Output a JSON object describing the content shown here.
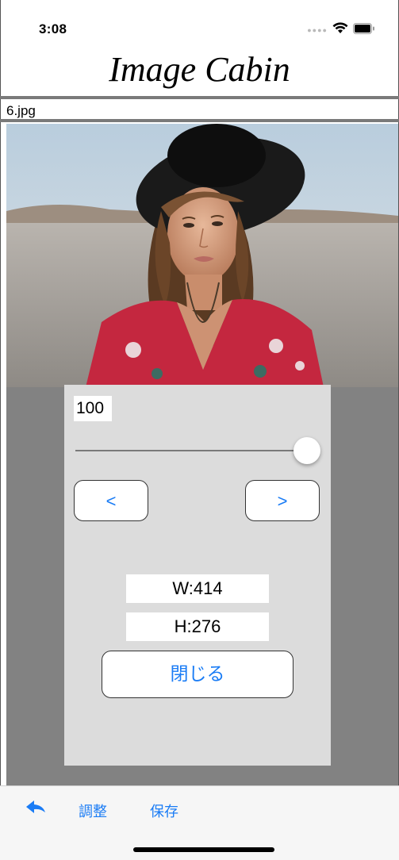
{
  "status_bar": {
    "time": "3:08",
    "icons": [
      "signal-icon",
      "wifi-icon",
      "battery-icon"
    ]
  },
  "header": {
    "title": "Image Cabin"
  },
  "file": {
    "name": "6.jpg"
  },
  "photo": {
    "subject": "portrait-photo"
  },
  "panel": {
    "value": "100",
    "slider_value": 100,
    "prev_label": "<",
    "next_label": ">",
    "width_label": "W:414",
    "height_label": "H:276",
    "close_label": "閉じる"
  },
  "toolbar": {
    "back_icon": "reply-arrow-icon",
    "adjust_label": "調整",
    "save_label": "保存"
  },
  "colors": {
    "accent": "#1a7cf5",
    "panel_bg": "#dcdcdc",
    "backdrop": "#828282"
  }
}
